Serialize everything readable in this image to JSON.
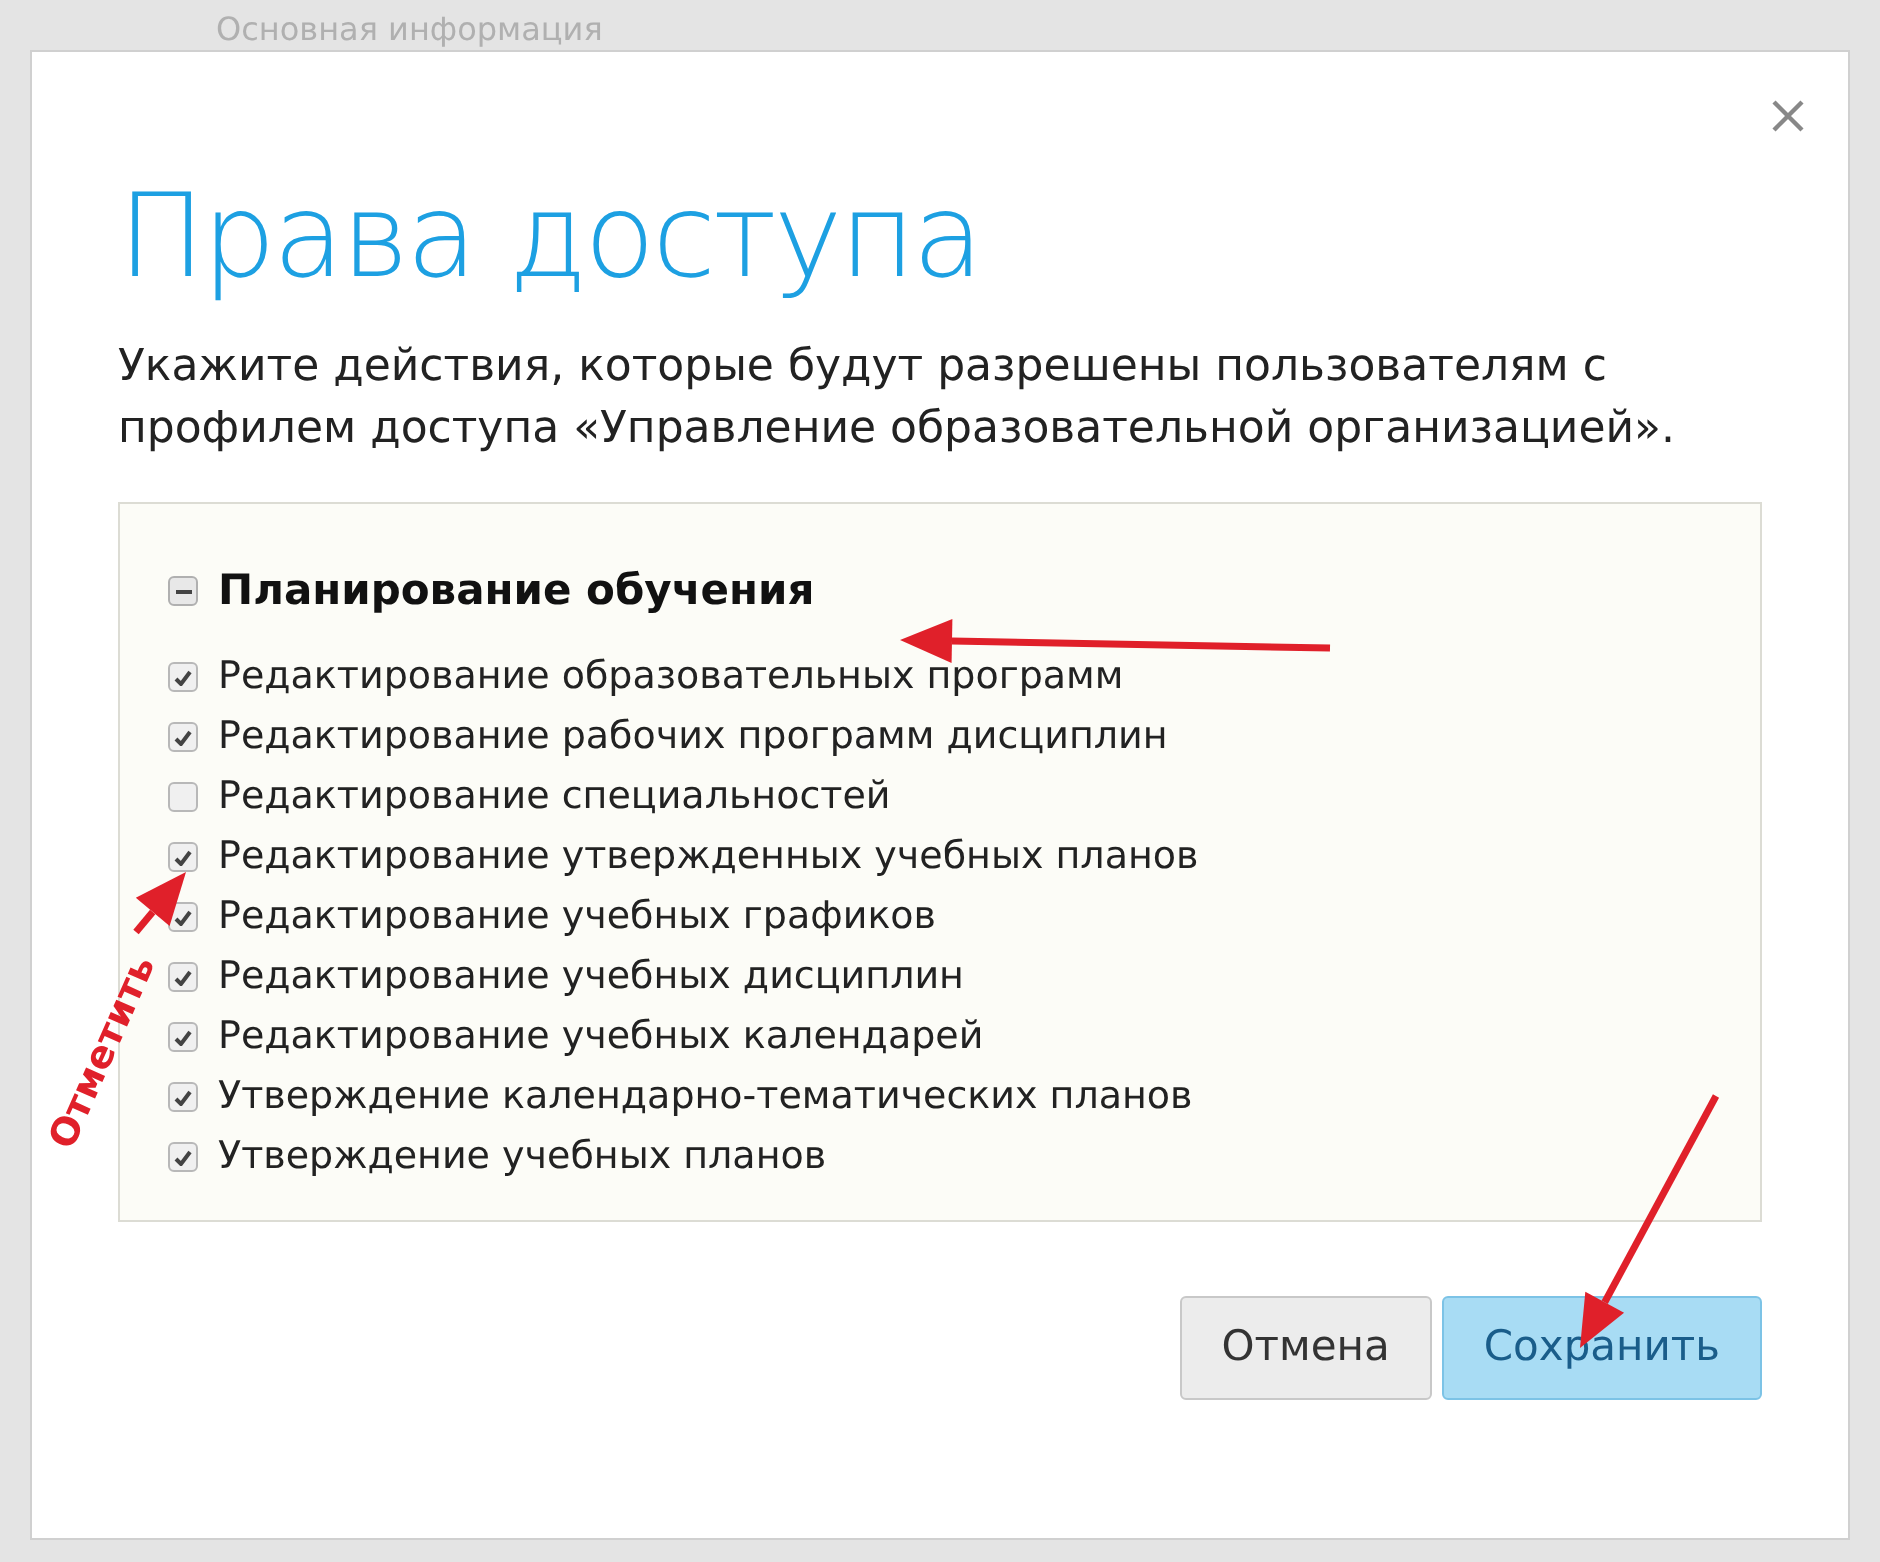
{
  "background": {
    "section_title": "Основная информация"
  },
  "dialog": {
    "title": "Права доступа",
    "description": "Укажите действия, которые будут разрешены пользователям с профилем доступа «Управление образовательной организацией».",
    "group": {
      "label": "Планирование обучения",
      "expanded": true,
      "items": [
        {
          "label": "Редактирование образовательных программ",
          "checked": true
        },
        {
          "label": "Редактирование рабочих программ дисциплин",
          "checked": true
        },
        {
          "label": "Редактирование специальностей",
          "checked": false
        },
        {
          "label": "Редактирование утвержденных учебных планов",
          "checked": true
        },
        {
          "label": "Редактирование учебных графиков",
          "checked": true
        },
        {
          "label": "Редактирование учебных дисциплин",
          "checked": true
        },
        {
          "label": "Редактирование учебных календарей",
          "checked": true
        },
        {
          "label": "Утверждение календарно-тематических планов",
          "checked": true
        },
        {
          "label": "Утверждение учебных планов",
          "checked": true
        }
      ]
    },
    "buttons": [
      {
        "label": "Отмена",
        "kind": "secondary"
      },
      {
        "label": "Сохранить",
        "kind": "primary"
      }
    ]
  },
  "annotations": {
    "mark_label": "Отметить"
  }
}
